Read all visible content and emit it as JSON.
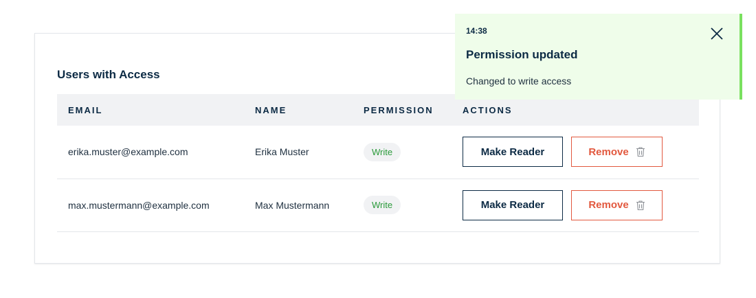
{
  "card": {
    "title": "Users with Access",
    "columns": [
      "Email",
      "Name",
      "Permission",
      "Actions"
    ]
  },
  "rows": [
    {
      "email": "erika.muster@example.com",
      "name": "Erika Muster",
      "permission": "Write",
      "action_primary": "Make Reader",
      "action_remove": "Remove"
    },
    {
      "email": "max.mustermann@example.com",
      "name": "Max Mustermann",
      "permission": "Write",
      "action_primary": "Make Reader",
      "action_remove": "Remove"
    }
  ],
  "toast": {
    "time": "14:38",
    "title": "Permission updated",
    "message": "Changed to write access",
    "close_icon": "close-icon"
  },
  "colors": {
    "navy": "#0c2a44",
    "remove": "#e2583e",
    "write_badge": "#2a9a3a",
    "toast_bg": "#effdea",
    "toast_accent": "#79e05f"
  }
}
